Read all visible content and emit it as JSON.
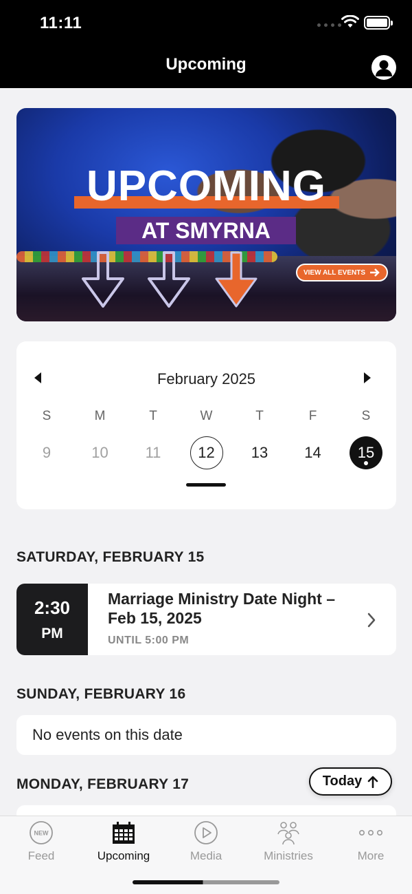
{
  "status_bar": {
    "time": "11:11"
  },
  "header": {
    "title": "Upcoming",
    "profile_icon": "person-circle-icon"
  },
  "banner": {
    "title": "UPCOMING",
    "subtitle": "AT SMYRNA",
    "cta_label": "VIEW ALL EVENTS",
    "colors": {
      "orange": "#e8662c",
      "purple": "#5b2c86",
      "blue": "#1a3aa8"
    }
  },
  "calendar": {
    "month_label": "February 2025",
    "weekdays": [
      "S",
      "M",
      "T",
      "W",
      "T",
      "F",
      "S"
    ],
    "days": [
      {
        "label": "9",
        "state": "past"
      },
      {
        "label": "10",
        "state": "past"
      },
      {
        "label": "11",
        "state": "past"
      },
      {
        "label": "12",
        "state": "today"
      },
      {
        "label": "13",
        "state": "future"
      },
      {
        "label": "14",
        "state": "future"
      },
      {
        "label": "15",
        "state": "selected"
      }
    ]
  },
  "sections": [
    {
      "heading": "SATURDAY, FEBRUARY 15",
      "event": {
        "time": "2:30",
        "ampm": "PM",
        "title": "Marriage Ministry Date Night – Feb 15, 2025",
        "until": "UNTIL 5:00 PM"
      }
    },
    {
      "heading": "SUNDAY, FEBRUARY 16",
      "empty_text": "No events on this date"
    },
    {
      "heading": "MONDAY, FEBRUARY 17"
    }
  ],
  "today_button": {
    "label": "Today"
  },
  "tabbar": {
    "items": [
      {
        "label": "Feed",
        "icon": "new-badge-icon",
        "badge_text": "NEW",
        "active": false
      },
      {
        "label": "Upcoming",
        "icon": "calendar-icon",
        "active": true
      },
      {
        "label": "Media",
        "icon": "play-circle-icon",
        "active": false
      },
      {
        "label": "Ministries",
        "icon": "people-icon",
        "active": false
      },
      {
        "label": "More",
        "icon": "more-dots-icon",
        "active": false
      }
    ]
  }
}
